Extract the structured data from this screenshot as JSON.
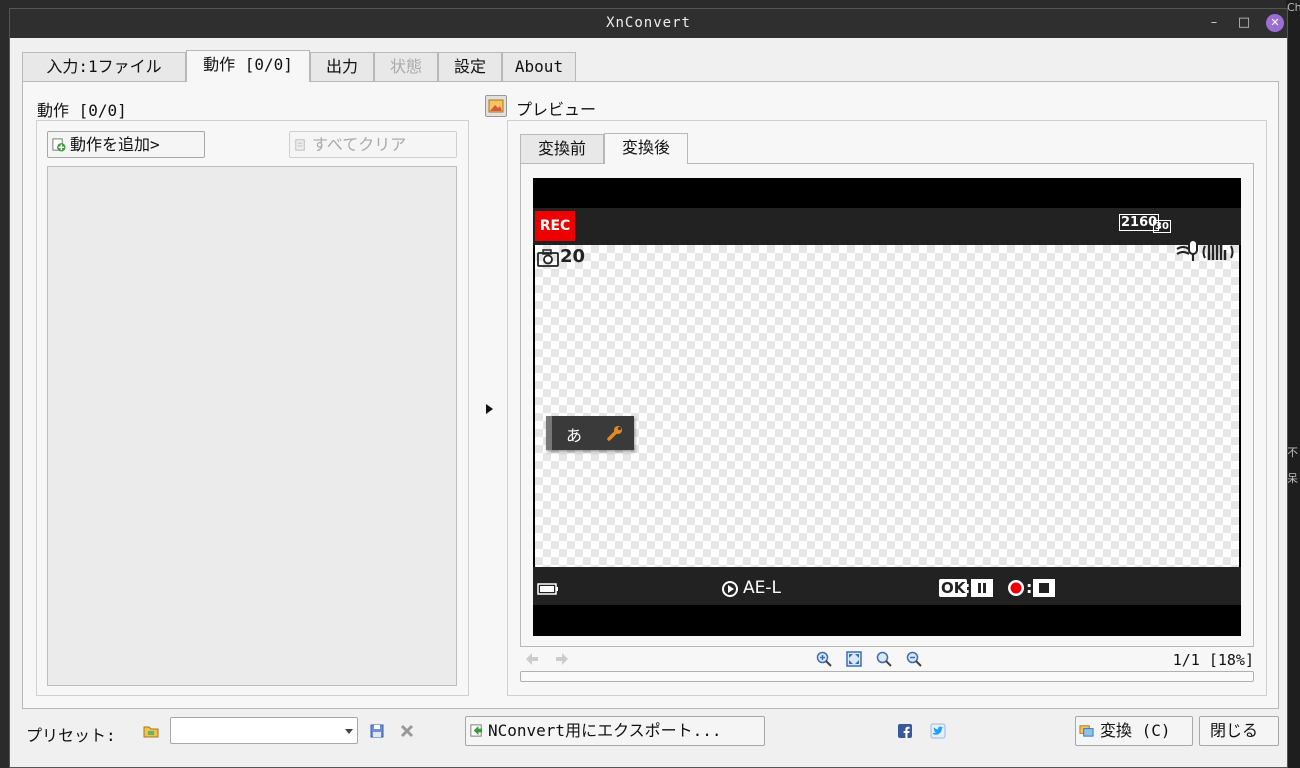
{
  "window": {
    "title": "XnConvert"
  },
  "tabs": [
    {
      "label": "入力:1ファイル",
      "active": false,
      "disabled": false
    },
    {
      "label": "動作 [0/0]",
      "active": true,
      "disabled": false
    },
    {
      "label": "出力",
      "active": false,
      "disabled": false
    },
    {
      "label": "状態",
      "active": false,
      "disabled": true
    },
    {
      "label": "設定",
      "active": false,
      "disabled": false
    },
    {
      "label": "About",
      "active": false,
      "disabled": false
    }
  ],
  "actions": {
    "title": "動作 [0/0]",
    "add_button": "動作を追加>",
    "clear_button": "すべてクリア"
  },
  "preview": {
    "title": "プレビュー",
    "tabs": [
      {
        "label": "変換前",
        "active": false
      },
      {
        "label": "変換後",
        "active": true
      }
    ],
    "osd": {
      "rec": "REC",
      "resolution": "2160",
      "frame_rate": "30",
      "shots": "20",
      "ael": "AE-L",
      "ok": "OK",
      "colon": ":",
      "float_char": "あ"
    },
    "page_zoom": "1/1 [18%]"
  },
  "bottom": {
    "preset_label": "プリセット:",
    "preset_value": "",
    "export_button": "NConvert用にエクスポート...",
    "convert_button": "変換 (C)",
    "close_button": "閉じる"
  },
  "desktop": {
    "side_text": [
      "Ch",
      "不",
      "呆"
    ]
  },
  "colors": {
    "rec": "#ee0000",
    "titlebar": "#2f2f2f",
    "close": "#9b6fd1",
    "accent": "#4a90d9"
  }
}
